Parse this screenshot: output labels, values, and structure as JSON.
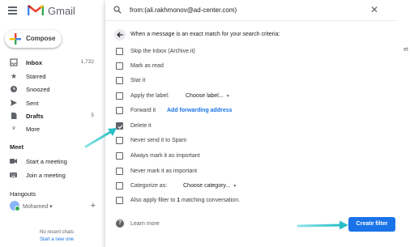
{
  "app": {
    "brand": "Gmail"
  },
  "compose": {
    "label": "Compose"
  },
  "nav": [
    {
      "label": "Inbox",
      "count": "1,732",
      "icon": "inbox-icon",
      "bold": true
    },
    {
      "label": "Starred",
      "count": "",
      "icon": "star-icon",
      "bold": false
    },
    {
      "label": "Snoozed",
      "count": "",
      "icon": "clock-icon",
      "bold": false
    },
    {
      "label": "Sent",
      "count": "",
      "icon": "send-icon",
      "bold": false
    },
    {
      "label": "Drafts",
      "count": "5",
      "icon": "draft-icon",
      "bold": true
    },
    {
      "label": "More",
      "count": "",
      "icon": "chevron-down-icon",
      "bold": false
    }
  ],
  "meet": {
    "heading": "Meet",
    "start": "Start a meeting",
    "join": "Join a meeting"
  },
  "hangouts": {
    "heading": "Hangouts",
    "user": "Mohamed",
    "no_chats": "No recent chats",
    "start_new": "Start a new one"
  },
  "search": {
    "query": "from:(ali.rakhmonov@ad-center.com)"
  },
  "filter": {
    "criteria": "When a message is an exact match for your search criteria:",
    "options": [
      {
        "label": "Skip the Inbox (Archive it)",
        "checked": false
      },
      {
        "label": "Mark as read",
        "checked": false
      },
      {
        "label": "Star it",
        "checked": false
      },
      {
        "label": "Apply the label:",
        "checked": false,
        "select": "Choose label..."
      },
      {
        "label": "Forward it",
        "checked": false,
        "link": "Add forwarding address"
      },
      {
        "label": "Delete it",
        "checked": true
      },
      {
        "label": "Never send it to Spam",
        "checked": false
      },
      {
        "label": "Always mark it as important",
        "checked": false
      },
      {
        "label": "Never mark it as important",
        "checked": false
      },
      {
        "label": "Categorize as:",
        "checked": false,
        "select": "Choose category..."
      },
      {
        "label_prefix": "Also apply filter to ",
        "label_bold": "1",
        "label_suffix": " matching conversation.",
        "checked": false
      }
    ],
    "learn_more": "Learn more",
    "create_button": "Create filter"
  },
  "colors": {
    "accent": "#1a73e8",
    "annotation_arrow": "#2bbfc9"
  }
}
